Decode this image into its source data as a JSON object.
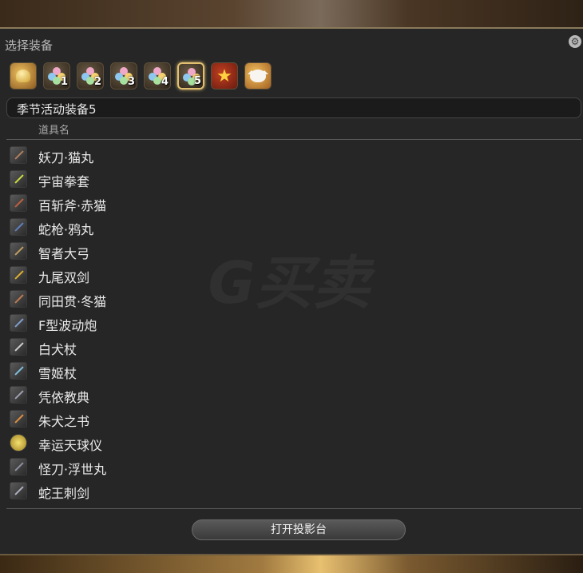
{
  "window": {
    "title": "选择装备",
    "settings_icon": "gear-icon"
  },
  "tabs": [
    {
      "icon": "bell-icon",
      "label": ""
    },
    {
      "icon": "flower-icon",
      "label": "1"
    },
    {
      "icon": "flower-icon",
      "label": "2"
    },
    {
      "icon": "flower-icon",
      "label": "3"
    },
    {
      "icon": "flower-icon",
      "label": "4"
    },
    {
      "icon": "flower-icon",
      "label": "5",
      "active": true
    },
    {
      "icon": "star-icon",
      "label": ""
    },
    {
      "icon": "moogle-icon",
      "label": ""
    }
  ],
  "category": {
    "label": "季节活动装备5"
  },
  "list": {
    "column_header": "道具名",
    "items": [
      {
        "name": "妖刀·猫丸"
      },
      {
        "name": "宇宙拳套"
      },
      {
        "name": "百斩斧·赤猫"
      },
      {
        "name": "蛇枪·鸦丸"
      },
      {
        "name": "智者大弓"
      },
      {
        "name": "九尾双剑"
      },
      {
        "name": "同田贯·冬猫"
      },
      {
        "name": "F型波动炮"
      },
      {
        "name": "白犬杖"
      },
      {
        "name": "雪姬杖"
      },
      {
        "name": "凭依教典"
      },
      {
        "name": "朱犬之书"
      },
      {
        "name": "幸运天球仪"
      },
      {
        "name": "怪刀·浮世丸"
      },
      {
        "name": "蛇王刺剑"
      }
    ]
  },
  "actions": {
    "open_projection": "打开投影台"
  },
  "watermark": {
    "text": "G买卖"
  },
  "colors": {
    "active_tab": "#e0c070",
    "panel": "#262626",
    "text": "#eaeaea"
  }
}
